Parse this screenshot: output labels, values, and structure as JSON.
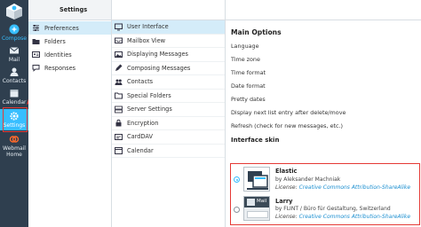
{
  "rail": {
    "items": [
      {
        "label": "Compose",
        "icon": "compose-icon"
      },
      {
        "label": "Mail",
        "icon": "mail-icon"
      },
      {
        "label": "Contacts",
        "icon": "contacts-icon"
      },
      {
        "label": "Calendar",
        "icon": "calendar-icon"
      },
      {
        "label": "Settings",
        "icon": "gear-icon"
      },
      {
        "label": "Webmail Home",
        "icon": "webmail-home-icon"
      }
    ],
    "colors": {
      "background": "#2f3f4f",
      "active": "#37beff",
      "callout": "#e53935"
    }
  },
  "settings": {
    "title": "Settings",
    "items": [
      {
        "label": "Preferences",
        "icon": "sliders-icon",
        "selected": true
      },
      {
        "label": "Folders",
        "icon": "folder-icon",
        "selected": false
      },
      {
        "label": "Identities",
        "icon": "id-card-icon",
        "selected": false
      },
      {
        "label": "Responses",
        "icon": "comment-icon",
        "selected": false
      }
    ]
  },
  "sections": {
    "items": [
      {
        "label": "User Interface",
        "icon": "monitor-icon",
        "selected": true
      },
      {
        "label": "Mailbox View",
        "icon": "mailbox-icon",
        "selected": false
      },
      {
        "label": "Displaying Messages",
        "icon": "image-icon",
        "selected": false
      },
      {
        "label": "Composing Messages",
        "icon": "pen-icon",
        "selected": false
      },
      {
        "label": "Contacts",
        "icon": "people-icon",
        "selected": false
      },
      {
        "label": "Special Folders",
        "icon": "folder-icon",
        "selected": false
      },
      {
        "label": "Server Settings",
        "icon": "server-icon",
        "selected": false
      },
      {
        "label": "Encryption",
        "icon": "lock-icon",
        "selected": false
      },
      {
        "label": "CardDAV",
        "icon": "card-icon",
        "selected": false
      },
      {
        "label": "Calendar",
        "icon": "calendar-icon",
        "selected": false
      }
    ]
  },
  "main": {
    "heading": "Main Options",
    "options": [
      "Language",
      "Time zone",
      "Time format",
      "Date format",
      "Pretty dates",
      "Display next list entry after delete/move",
      "Refresh (check for new messages, etc.)"
    ],
    "skin_heading": "Interface skin",
    "skins": [
      {
        "name": "Elastic",
        "by": "by Aleksander Machniak",
        "license_prefix": "License:",
        "license": "Creative Commons Attribution-ShareAlike",
        "selected": true
      },
      {
        "name": "Larry",
        "by": "by FLINT / Büro für Gestaltung, Switzerland",
        "license_prefix": "License:",
        "license": "Creative Commons Attribution-ShareAlike",
        "selected": false
      }
    ],
    "thumb_text": "Mail"
  }
}
